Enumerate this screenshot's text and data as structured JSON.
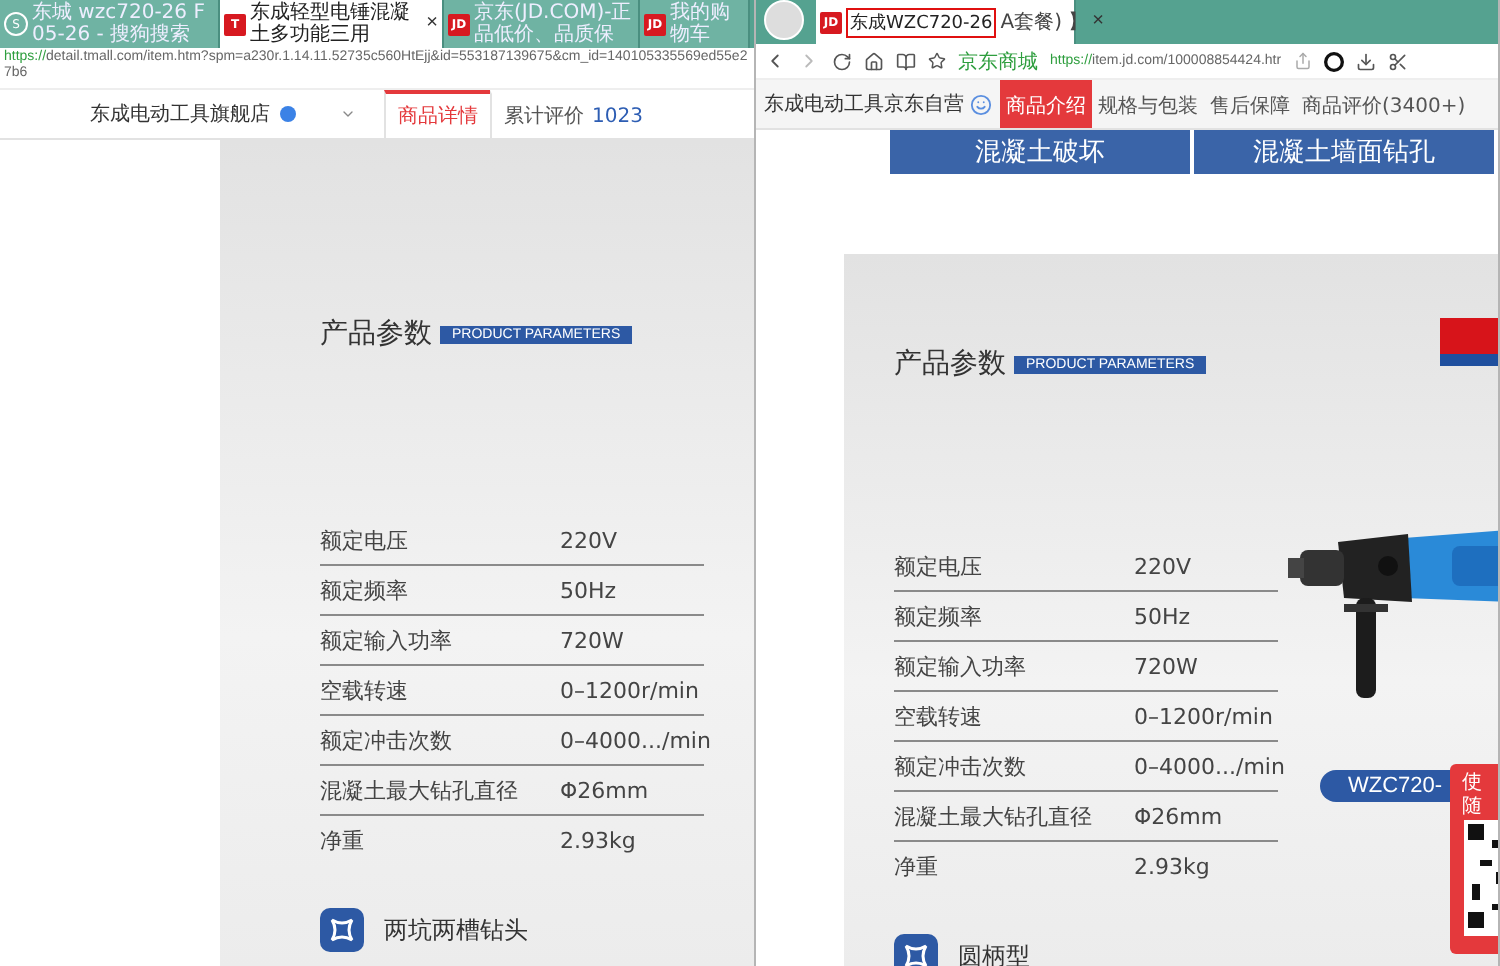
{
  "left_window": {
    "tabs": [
      {
        "kind": "circle",
        "icon_text": "S",
        "title": "东城 wzc720-26 F05-26 - 搜狗搜索",
        "selected": false
      },
      {
        "kind": "square",
        "icon_text": "T",
        "title": "东成轻型电锤混凝土多功能三用",
        "selected": true
      },
      {
        "kind": "square",
        "icon_text": "JD",
        "title": "京东(JD.COM)-正品低价、品质保",
        "selected": false
      },
      {
        "kind": "square",
        "icon_text": "JD",
        "title": "我的购物车",
        "selected": false
      }
    ],
    "close": "×",
    "url_scheme": "https://",
    "url_rest": "detail.tmall.com/item.htm?spm=a230r.1.14.11.52735c560HtEjj&id=553187139675&cm_id=140105335569ed55e27b6",
    "store_name": "东成电动工具旗舰店",
    "nav_tabs": [
      {
        "label": "商品详情",
        "selected": true
      },
      {
        "label": "累计评价",
        "count": "1023",
        "selected": false
      }
    ],
    "product": {
      "title": "产品参数",
      "tag": "PRODUCT PARAMETERS",
      "params": [
        {
          "name": "额定电压",
          "value": "220V"
        },
        {
          "name": "额定频率",
          "value": "50Hz"
        },
        {
          "name": "额定输入功率",
          "value": "720W"
        },
        {
          "name": "空载转速",
          "value": "0–1200r/min"
        },
        {
          "name": "额定冲击次数",
          "value": "0–4000.../min"
        },
        {
          "name": "混凝土最大钻孔直径",
          "value": "Φ26mm"
        },
        {
          "name": "净重",
          "value": "2.93kg"
        }
      ],
      "feature": "两坑两槽钻头"
    }
  },
  "right_window": {
    "tab": {
      "icon_text": "JD",
      "title": "东成WZC720-26",
      "title_highlighted": true,
      "title_tail": "A套餐) 】",
      "selected": true
    },
    "close": "×",
    "site_label": "京东商城",
    "url_scheme": "https://",
    "url_rest": "item.jd.com/100008854424.htr",
    "store_name": "东成电动工具京东自营",
    "nav_tabs": [
      {
        "label": "商品介绍",
        "selected": true
      },
      {
        "label": "规格与包装",
        "selected": false
      },
      {
        "label": "售后保障",
        "selected": false
      },
      {
        "label": "商品评价(3400+)",
        "selected": false
      }
    ],
    "banners": [
      "混凝土破坏",
      "混凝土墙面钻孔"
    ],
    "product": {
      "title": "产品参数",
      "tag": "PRODUCT PARAMETERS",
      "params": [
        {
          "name": "额定电压",
          "value": "220V"
        },
        {
          "name": "额定频率",
          "value": "50Hz"
        },
        {
          "name": "额定输入功率",
          "value": "720W"
        },
        {
          "name": "空载转速",
          "value": "0–1200r/min"
        },
        {
          "name": "额定冲击次数",
          "value": "0–4000.../min"
        },
        {
          "name": "混凝土最大钻孔直径",
          "value": "Φ26mm"
        },
        {
          "name": "净重",
          "value": "2.93kg"
        }
      ],
      "feature": "圆柄型",
      "model_pill": "WZC720-"
    },
    "qr_panel": {
      "lines": [
        "使",
        "随"
      ]
    }
  }
}
